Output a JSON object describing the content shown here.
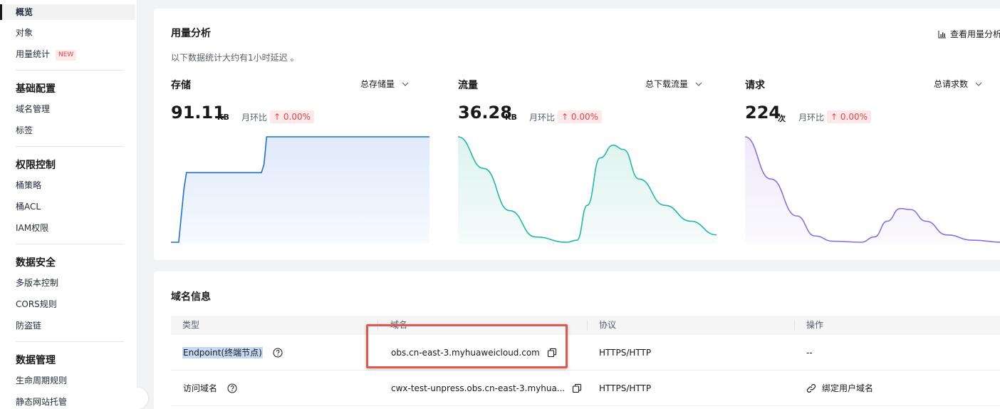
{
  "sidebar": {
    "items": [
      {
        "label": "概览",
        "active": true
      },
      {
        "label": "对象"
      },
      {
        "label": "用量统计",
        "badge": "NEW"
      }
    ],
    "groups": [
      {
        "title": "基础配置",
        "items": [
          "域名管理",
          "标签"
        ]
      },
      {
        "title": "权限控制",
        "items": [
          "桶策略",
          "桶ACL",
          "IAM权限"
        ]
      },
      {
        "title": "数据安全",
        "items": [
          "多版本控制",
          "CORS规则",
          "防盗链"
        ]
      },
      {
        "title": "数据管理",
        "items": [
          "生命周期规则",
          "静态网站托管"
        ]
      }
    ]
  },
  "usage": {
    "title": "用量分析",
    "note": "以下数据统计大约有1小时延迟 。",
    "view_link": "查看用量分析",
    "metrics": [
      {
        "title": "存储",
        "select": "总存储量",
        "value": "91.11",
        "unit": "KB",
        "mom_label": "月环比",
        "mom": "↑ 0.00%",
        "color": "#1f6fd6",
        "fill": "#dfeafb",
        "curve": [
          [
            0,
            0
          ],
          [
            0.03,
            0
          ],
          [
            0.05,
            0.5
          ],
          [
            0.06,
            0.66
          ],
          [
            0.35,
            0.66
          ],
          [
            0.36,
            0.74
          ],
          [
            0.37,
            1
          ],
          [
            1,
            1
          ]
        ]
      },
      {
        "title": "流量",
        "select": "总下载流量",
        "value": "36.28",
        "unit": "KB",
        "mom_label": "月环比",
        "mom": "↑ 0.00%",
        "color": "#22b8a8",
        "fill": "#dcf3ef",
        "curve": [
          [
            0,
            1
          ],
          [
            0.1,
            0.7
          ],
          [
            0.2,
            0.3
          ],
          [
            0.3,
            0.05
          ],
          [
            0.42,
            0
          ],
          [
            0.46,
            0.02
          ],
          [
            0.5,
            0.35
          ],
          [
            0.55,
            0.8
          ],
          [
            0.6,
            0.92
          ],
          [
            0.64,
            0.88
          ],
          [
            0.7,
            0.6
          ],
          [
            0.8,
            0.35
          ],
          [
            0.9,
            0.2
          ],
          [
            1,
            0.07
          ]
        ]
      },
      {
        "title": "请求",
        "select": "总请求数",
        "value": "224",
        "unit": "次",
        "mom_label": "月环比",
        "mom": "↑ 0.00%",
        "color": "#8b6fe0",
        "fill": "#efeafb",
        "curve": [
          [
            0,
            1
          ],
          [
            0.1,
            0.6
          ],
          [
            0.2,
            0.25
          ],
          [
            0.27,
            0.06
          ],
          [
            0.34,
            0.01
          ],
          [
            0.45,
            0
          ],
          [
            0.5,
            0.05
          ],
          [
            0.55,
            0.2
          ],
          [
            0.6,
            0.32
          ],
          [
            0.64,
            0.31
          ],
          [
            0.7,
            0.2
          ],
          [
            0.78,
            0.07
          ],
          [
            0.88,
            0.02
          ],
          [
            1,
            0
          ]
        ]
      }
    ]
  },
  "domain": {
    "title": "域名信息",
    "columns": [
      "类型",
      "域名",
      "协议",
      "操作"
    ],
    "rows": [
      {
        "type": "Endpoint(终端节点)",
        "domain": "obs.cn-east-3.myhuaweicloud.com",
        "protocol": "HTTPS/HTTP",
        "action": "--"
      },
      {
        "type": "访问域名",
        "domain": "cwx-test-unpress.obs.cn-east-3.myhua...",
        "protocol": "HTTPS/HTTP",
        "action": "绑定用户域名"
      }
    ]
  }
}
